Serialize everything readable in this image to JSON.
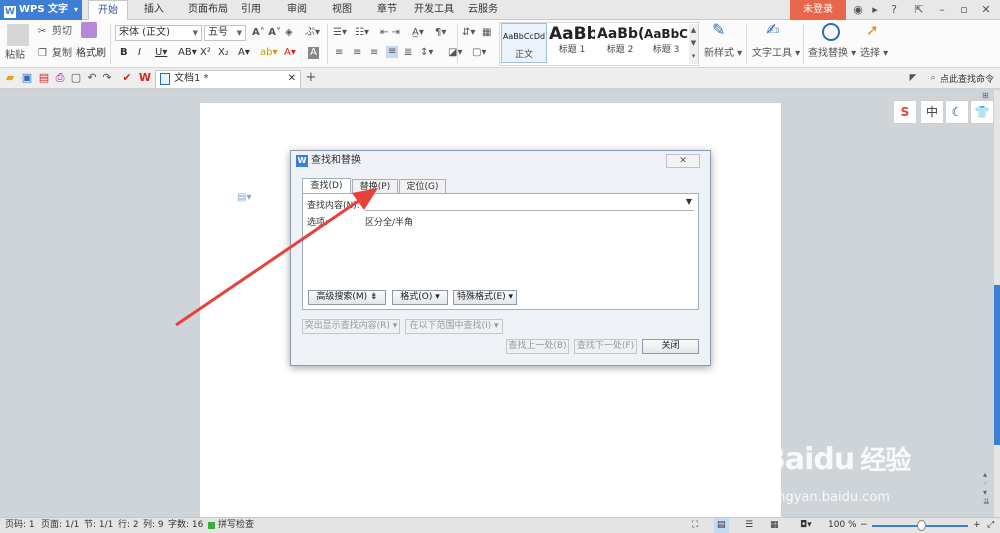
{
  "app": {
    "name": "WPS 文字",
    "logo": "W"
  },
  "menu": {
    "tabs": [
      "开始",
      "插入",
      "页面布局",
      "引用",
      "审阅",
      "视图",
      "章节",
      "开发工具",
      "云服务"
    ],
    "login": "未登录"
  },
  "ribbon": {
    "clipboard": {
      "paste": "粘贴",
      "cut": "剪切",
      "copy": "复制",
      "format_painter": "格式刷"
    },
    "font": {
      "name": "宋体 (正文)",
      "size": "五号"
    },
    "styles": [
      {
        "preview": "AaBbCcDd",
        "label": "正文"
      },
      {
        "preview": "AaBb",
        "label": "标题 1"
      },
      {
        "preview": "AaBb(",
        "label": "标题 2"
      },
      {
        "preview": "AaBbC",
        "label": "标题 3"
      }
    ],
    "new_style": "新样式",
    "text_tools": "文字工具",
    "find_replace": "查找替换",
    "select": "选择"
  },
  "quickbar": {
    "doc_tab": "文档1 *",
    "search_command": "点此查找命令"
  },
  "dialog": {
    "title": "查找和替换",
    "tabs": [
      "查找(D)",
      "替换(P)",
      "定位(G)"
    ],
    "find_label": "查找内容(N):",
    "options_label": "选项:",
    "options_value": "区分全/半角",
    "advanced": "高级搜索(M)",
    "format": "格式(O)",
    "special": "特殊格式(E)",
    "highlight": "突出显示查找内容(R)",
    "find_in": "在以下范围中查找(I)",
    "find_prev": "查找上一处(B)",
    "find_next": "查找下一处(F)",
    "close": "关闭"
  },
  "status": {
    "page": "页码: 1",
    "pages": "页面: 1/1",
    "section": "节: 1/1",
    "row": "行: 2",
    "col": "列: 9",
    "words": "字数: 16",
    "spell": "拼写检查",
    "zoom": "100 %"
  },
  "watermark": {
    "brand": "Baidu",
    "brand_cn": "经验",
    "url": "jingyan.baidu.com"
  },
  "colors": {
    "accent": "#3d7fd4",
    "login": "#e8674c",
    "arrow": "#e8413c"
  }
}
